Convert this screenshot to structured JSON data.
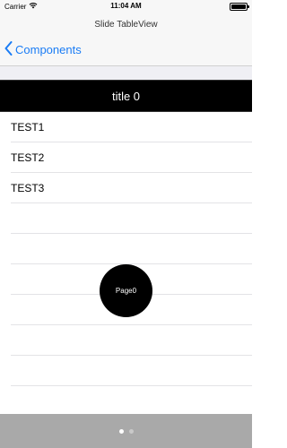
{
  "status_bar": {
    "carrier": "Carrier",
    "time": "11:04 AM",
    "wifi_icon": "wifi-icon",
    "battery_icon": "battery-icon"
  },
  "nav": {
    "title": "Slide TableView",
    "back_label": "Components",
    "back_icon": "chevron-left-icon",
    "accent_color": "#1a7cf5"
  },
  "section": {
    "header": "title 0"
  },
  "table": {
    "rows": [
      "TEST1",
      "TEST2",
      "TEST3",
      "",
      "",
      "",
      "",
      "",
      ""
    ]
  },
  "page_button": {
    "label": "Page0"
  },
  "pager": {
    "page_count": 2,
    "current_page": 1
  }
}
